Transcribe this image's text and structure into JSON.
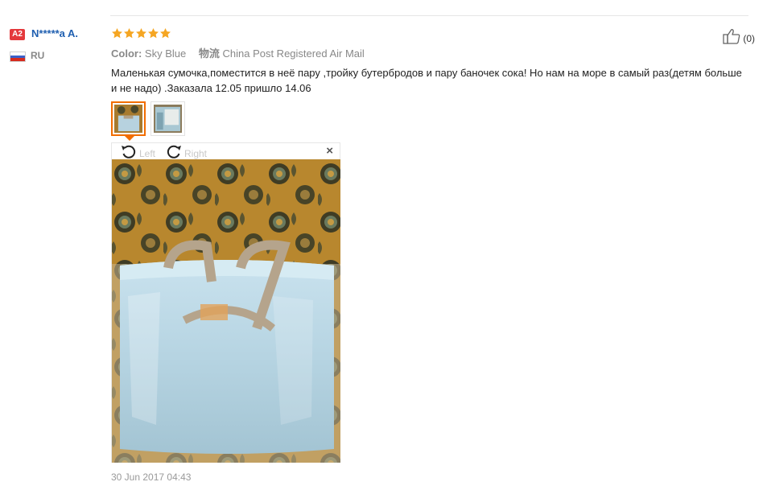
{
  "review": {
    "user": {
      "level": "A2",
      "name": "N*****a A.",
      "country": "RU"
    },
    "rating": 5,
    "helpful": {
      "count": "(0)"
    },
    "attributes": {
      "color_label": "Color:",
      "color_value": "Sky Blue",
      "shipping_label": "物流",
      "shipping_value": "China Post Registered Air Mail"
    },
    "text": "Маленькая сумочка,поместится в неё пару ,тройку бутербродов и пару баночек сока! Но нам на море в самый раз(детям больше и не надо) .Заказала 12.05 пришло 14.06",
    "thumbnails": [
      {
        "name": "photo-1",
        "active": true
      },
      {
        "name": "photo-2",
        "active": false
      }
    ],
    "viewer": {
      "rotate_left_label": "Left",
      "rotate_right_label": "Right",
      "close_label": "×"
    },
    "date": "30 Jun 2017 04:43"
  },
  "colors": {
    "accent": "#f26d00",
    "star": "#f5a623",
    "username": "#1f5fb0",
    "badge": "#e4393c"
  },
  "icons": [
    "thumbs-up-icon",
    "rotate-left-icon",
    "rotate-right-icon",
    "close-icon",
    "star-icon",
    "flag-ru-icon"
  ]
}
